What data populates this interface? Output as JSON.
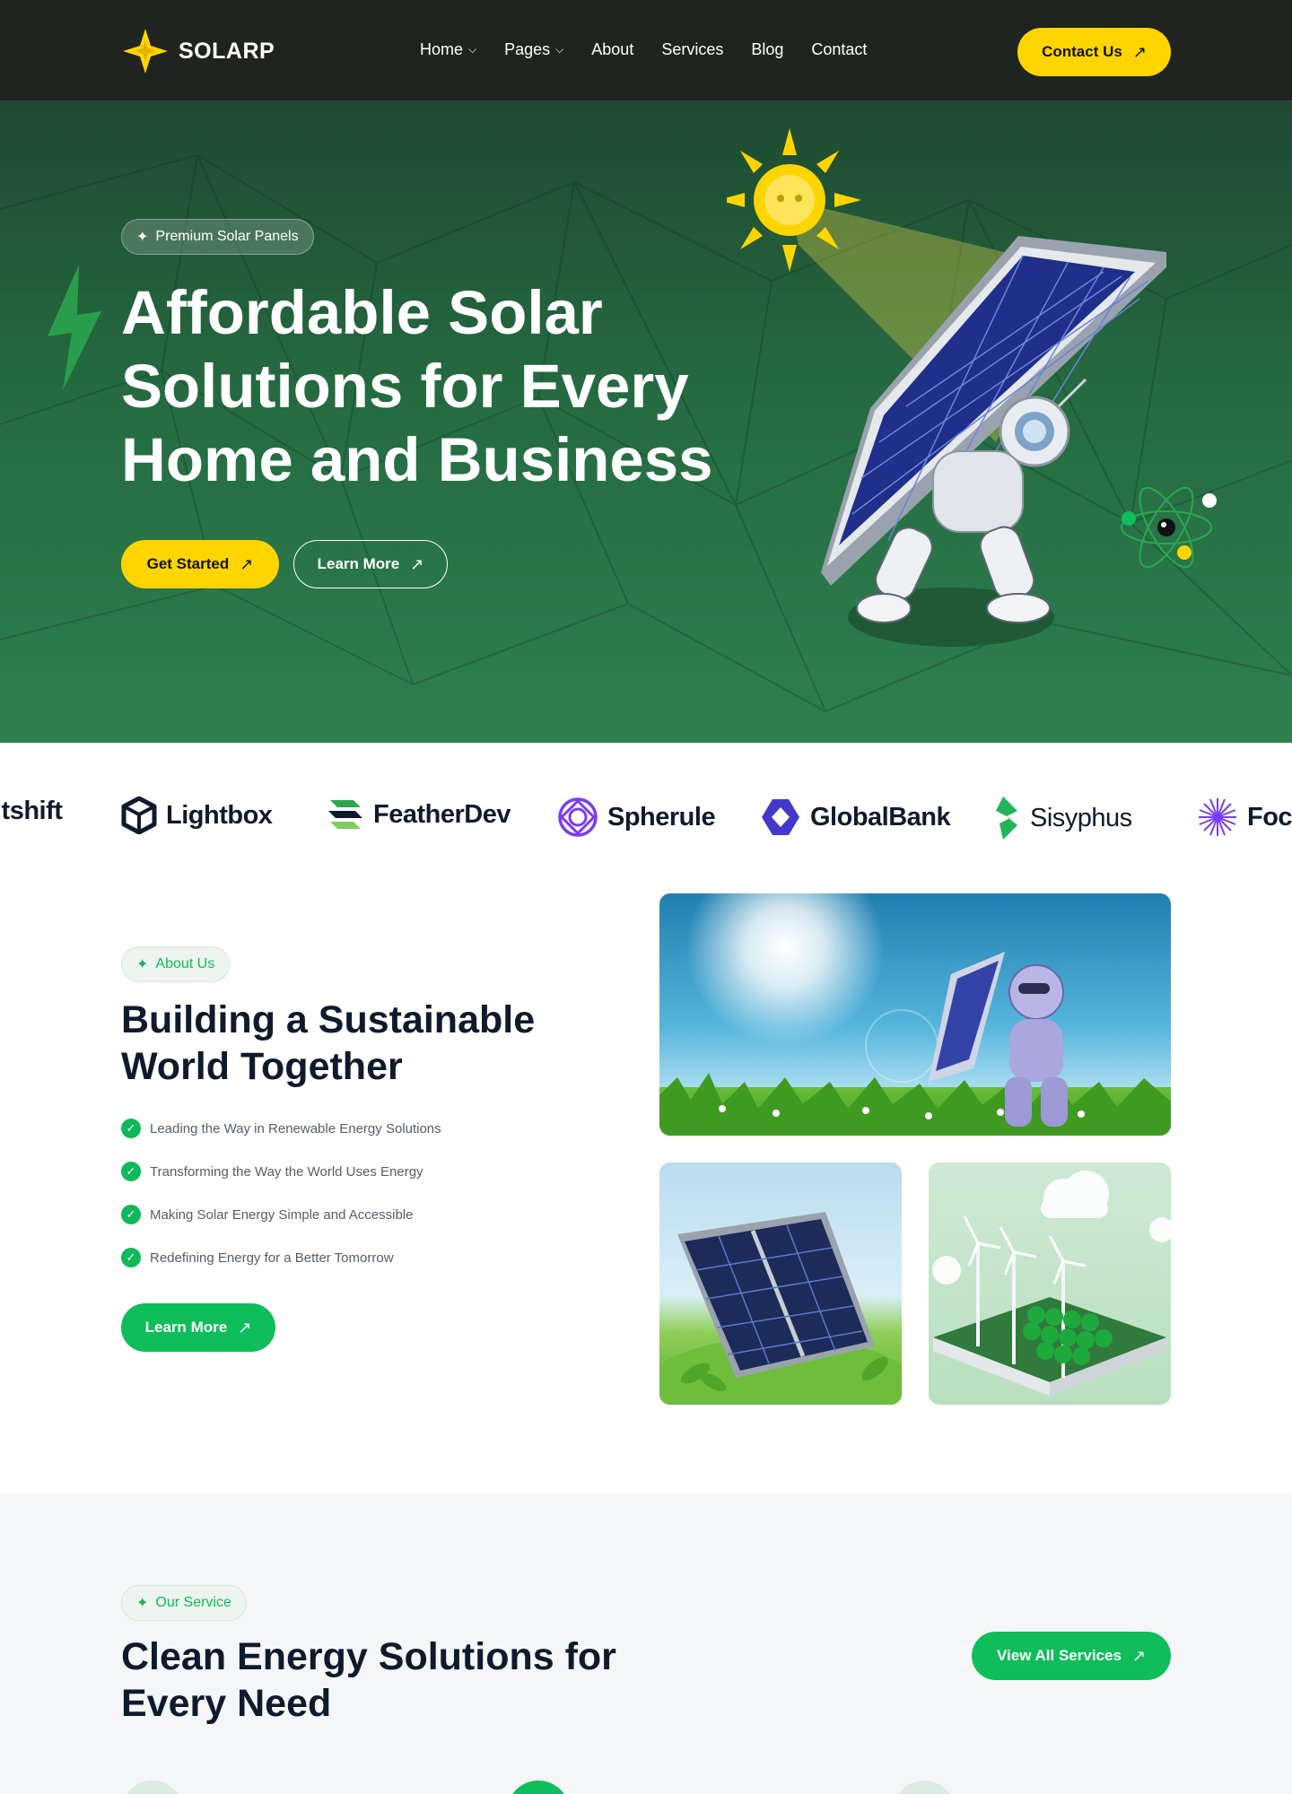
{
  "header": {
    "brand": "SOLARP",
    "nav": [
      {
        "label": "Home",
        "has_dropdown": true
      },
      {
        "label": "Pages",
        "has_dropdown": true
      },
      {
        "label": "About",
        "has_dropdown": false
      },
      {
        "label": "Services",
        "has_dropdown": false
      },
      {
        "label": "Blog",
        "has_dropdown": false
      },
      {
        "label": "Contact",
        "has_dropdown": false
      }
    ],
    "cta_label": "Contact Us"
  },
  "hero": {
    "tag": "Premium Solar Panels",
    "title": "Affordable Solar Solutions for Every Home and Business",
    "primary_cta": "Get Started",
    "secondary_cta": "Learn More"
  },
  "brands": [
    "ltshift",
    "Lightbox",
    "FeatherDev",
    "Spherule",
    "GlobalBank",
    "Sisyphus",
    "Foc"
  ],
  "about": {
    "tag": "About Us",
    "title": "Building a Sustainable World Together",
    "points": [
      "Leading the Way in Renewable Energy Solutions",
      "Transforming the Way the World Uses Energy",
      "Making Solar Energy Simple and Accessible",
      "Redefining Energy for a Better Tomorrow"
    ],
    "cta": "Learn More"
  },
  "services": {
    "tag": "Our Service",
    "title": "Clean Energy Solutions for Every Need",
    "cta": "View All Services"
  },
  "colors": {
    "accent_yellow": "#ffd500",
    "accent_green": "#0fbd5a",
    "hero_green": "#256a41",
    "header_bg": "#1f2421",
    "ink": "#0f1b2d"
  },
  "icons": {
    "logo": "four-point-star-icon",
    "arrow": "arrow-up-right-icon",
    "tag": "sparkle-icon",
    "check": "check-circle-icon",
    "dropdown": "chevron-down-icon"
  }
}
